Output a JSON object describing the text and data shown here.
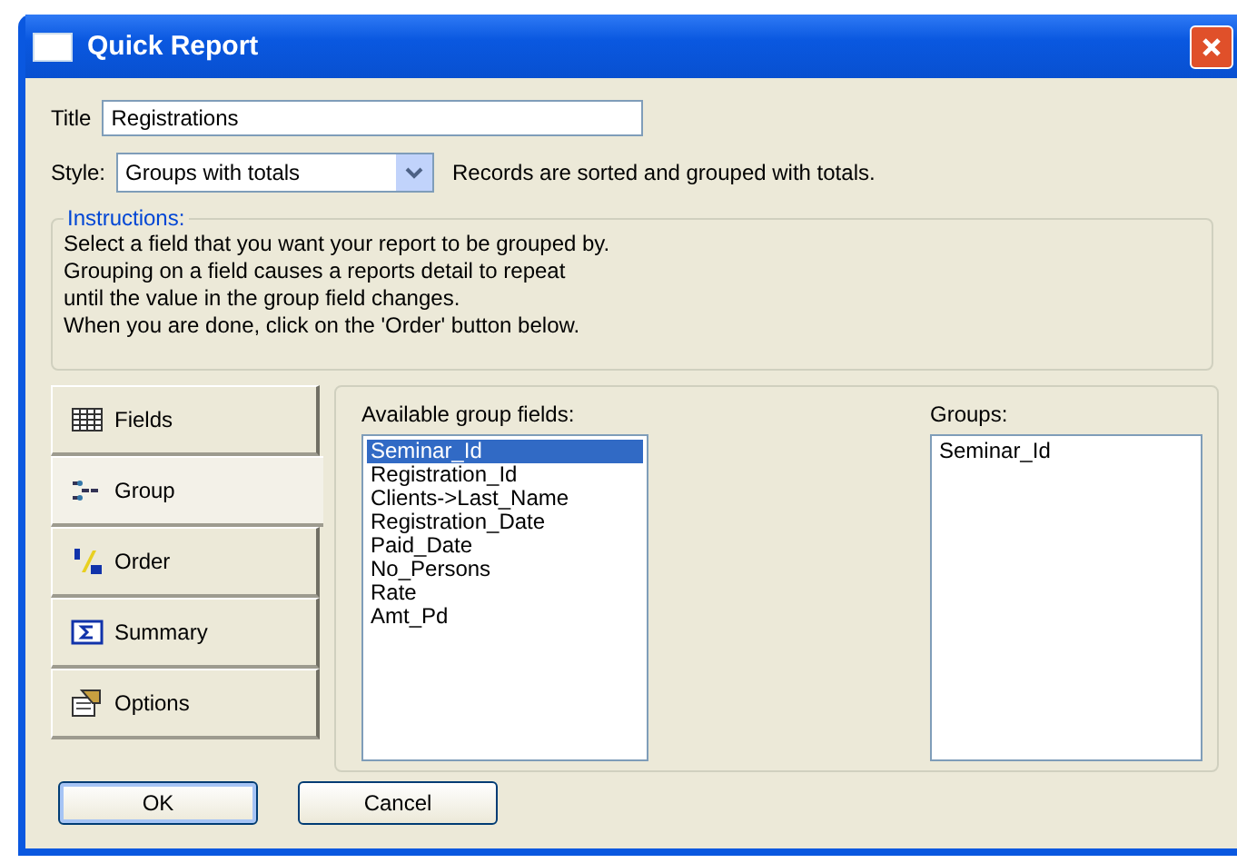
{
  "window": {
    "title": "Quick Report"
  },
  "title_field": {
    "label": "Title",
    "value": "Registrations"
  },
  "style_field": {
    "label": "Style:",
    "value": "Groups with totals",
    "description": "Records are sorted and grouped with totals."
  },
  "instructions": {
    "legend": "Instructions:",
    "lines": [
      "Select a field that you want your report to be grouped by.",
      "Grouping on a field causes a reports detail to repeat",
      "until the value in the group field changes.",
      "When you are done, click on the 'Order' button below."
    ]
  },
  "tabs": [
    {
      "label": "Fields",
      "kind": "fields",
      "selected": false
    },
    {
      "label": "Group",
      "kind": "group",
      "selected": true
    },
    {
      "label": "Order",
      "kind": "order",
      "selected": false
    },
    {
      "label": "Summary",
      "kind": "summary",
      "selected": false
    },
    {
      "label": "Options",
      "kind": "options",
      "selected": false
    }
  ],
  "available_list": {
    "label": "Available group fields:",
    "items": [
      {
        "text": "Seminar_Id",
        "selected": true
      },
      {
        "text": "Registration_Id",
        "selected": false
      },
      {
        "text": "Clients->Last_Name",
        "selected": false
      },
      {
        "text": "Registration_Date",
        "selected": false
      },
      {
        "text": "Paid_Date",
        "selected": false
      },
      {
        "text": "No_Persons",
        "selected": false
      },
      {
        "text": "Rate",
        "selected": false
      },
      {
        "text": "Amt_Pd",
        "selected": false
      }
    ]
  },
  "groups_list": {
    "label": "Groups:",
    "items": [
      {
        "text": "Seminar_Id",
        "selected": false
      }
    ]
  },
  "buttons": [
    {
      "label": "OK",
      "default": true
    },
    {
      "label": "Cancel",
      "default": false
    }
  ]
}
